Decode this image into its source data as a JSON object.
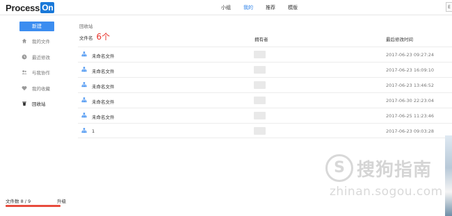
{
  "header": {
    "logo_text": "Process",
    "logo_badge": "On",
    "nav": [
      {
        "label": "小组",
        "active": false
      },
      {
        "label": "我的",
        "active": true
      },
      {
        "label": "推荐",
        "active": false
      },
      {
        "label": "模版",
        "active": false
      }
    ],
    "corner": "E"
  },
  "sidebar": {
    "new_button": "新建",
    "items": [
      {
        "label": "我的文件",
        "icon": "home-icon"
      },
      {
        "label": "最近修改",
        "icon": "clock-icon"
      },
      {
        "label": "与我协作",
        "icon": "people-icon"
      },
      {
        "label": "我的收藏",
        "icon": "heart-icon"
      },
      {
        "label": "回收站",
        "icon": "trash-icon",
        "active": true
      }
    ],
    "file_count": "文件数 8 / 9",
    "upgrade": "升级",
    "file_usage_fraction": 0.89
  },
  "main": {
    "breadcrumb": "回收站",
    "col_name": "文件名",
    "col_count": "6个",
    "col_owner": "拥有者",
    "col_time": "最后修改时间",
    "files": [
      {
        "name": "未命名文件",
        "time": "2017-06-23 09:27:24"
      },
      {
        "name": "未命名文件",
        "time": "2017-06-23 16:09:10"
      },
      {
        "name": "未命名文件",
        "time": "2017-06-23 13:46:52"
      },
      {
        "name": "未命名文件",
        "time": "2017-06-30 22:23:04"
      },
      {
        "name": "未命名文件",
        "time": "2017-06-25 11:23:46"
      },
      {
        "name": "1",
        "time": "2017-06-23 09:03:28"
      }
    ]
  },
  "watermark": {
    "logo_glyph": "S",
    "text": "搜狗指南",
    "url": "zhinan.sogou.com"
  },
  "colors": {
    "accent": "#3c8df0",
    "count_red": "#e8322a",
    "bar_red": "#e84c3d"
  }
}
